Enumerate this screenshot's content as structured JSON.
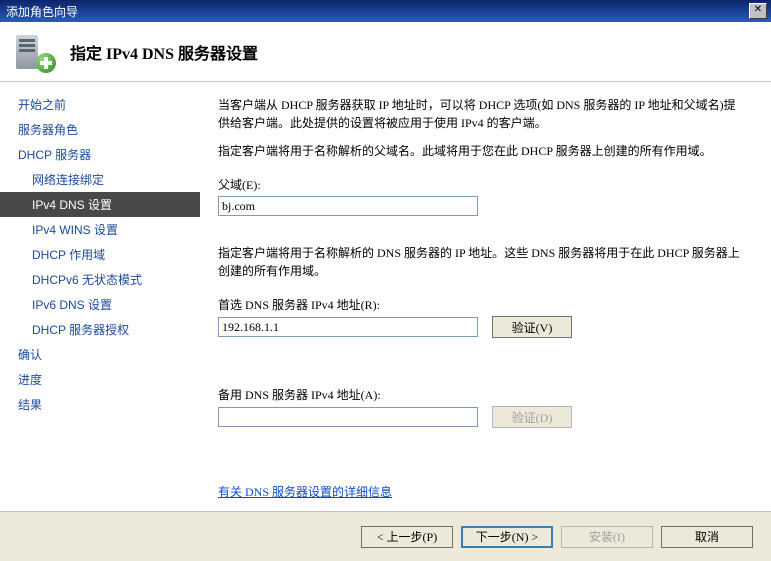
{
  "titlebar": {
    "title": "添加角色向导"
  },
  "header": {
    "title": "指定 IPv4 DNS 服务器设置"
  },
  "sidebar": {
    "items": [
      {
        "label": "开始之前",
        "sub": false,
        "selected": false
      },
      {
        "label": "服务器角色",
        "sub": false,
        "selected": false
      },
      {
        "label": "DHCP 服务器",
        "sub": false,
        "selected": false
      },
      {
        "label": "网络连接绑定",
        "sub": true,
        "selected": false
      },
      {
        "label": "IPv4 DNS 设置",
        "sub": true,
        "selected": true
      },
      {
        "label": "IPv4 WINS 设置",
        "sub": true,
        "selected": false
      },
      {
        "label": "DHCP 作用域",
        "sub": true,
        "selected": false
      },
      {
        "label": "DHCPv6 无状态模式",
        "sub": true,
        "selected": false
      },
      {
        "label": "IPv6 DNS 设置",
        "sub": true,
        "selected": false
      },
      {
        "label": "DHCP 服务器授权",
        "sub": true,
        "selected": false
      },
      {
        "label": "确认",
        "sub": false,
        "selected": false
      },
      {
        "label": "进度",
        "sub": false,
        "selected": false
      },
      {
        "label": "结果",
        "sub": false,
        "selected": false
      }
    ]
  },
  "content": {
    "desc1": "当客户端从 DHCP 服务器获取 IP 地址时，可以将 DHCP 选项(如 DNS 服务器的 IP 地址和父域名)提供给客户端。此处提供的设置将被应用于使用 IPv4 的客户端。",
    "desc2": "指定客户端将用于名称解析的父域名。此域将用于您在此 DHCP 服务器上创建的所有作用域。",
    "parent_label": "父域(E):",
    "parent_value": "bj.com",
    "desc3": "指定客户端将用于名称解析的 DNS 服务器的 IP 地址。这些 DNS 服务器将用于在此 DHCP 服务器上创建的所有作用域。",
    "pref_label": "首选 DNS 服务器 IPv4 地址(R):",
    "pref_value": "192.168.1.1",
    "alt_label": "备用 DNS 服务器 IPv4 地址(A):",
    "alt_value": "",
    "validate1": "验证(V)",
    "validate2": "验证(D)",
    "help_link": "有关 DNS 服务器设置的详细信息"
  },
  "footer": {
    "prev": "< 上一步(P)",
    "next": "下一步(N) >",
    "install": "安装(I)",
    "cancel": "取消"
  }
}
